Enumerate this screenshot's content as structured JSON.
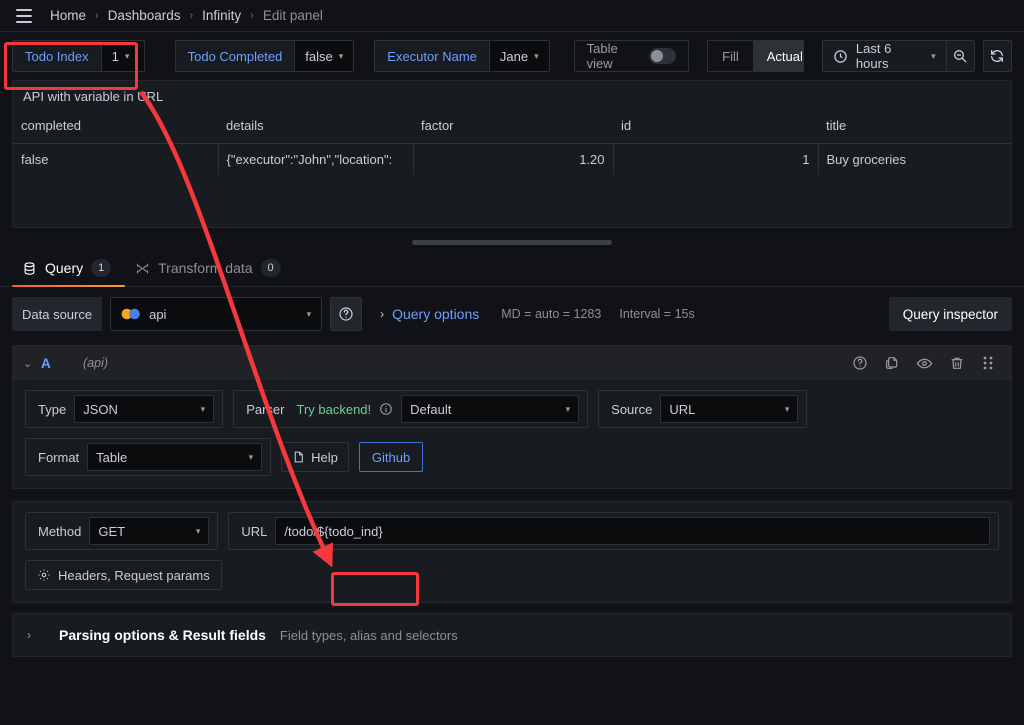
{
  "nav": {
    "menu_icon": "hamburger-menu-icon",
    "breadcrumbs": [
      {
        "label": "Home",
        "current": false
      },
      {
        "label": "Dashboards",
        "current": false
      },
      {
        "label": "Infinity",
        "current": false
      },
      {
        "label": "Edit panel",
        "current": true
      }
    ],
    "separator": "›"
  },
  "submenu": {
    "variables": [
      {
        "name": "Todo Index",
        "value": "1"
      },
      {
        "name": "Todo Completed",
        "value": "false"
      },
      {
        "name": "Executor Name",
        "value": "Jane"
      }
    ],
    "table_view": {
      "label": "Table view",
      "enabled": false
    },
    "fill_actual": {
      "options": [
        "Fill",
        "Actual"
      ],
      "selected": "Actual"
    },
    "time_picker": {
      "icon": "clock-icon",
      "range": "Last 6 hours",
      "caret": "⌄"
    },
    "zoom_out_icon": "zoom-out-icon",
    "refresh_icon": "refresh-icon"
  },
  "panel": {
    "title": "API with variable in URL",
    "table": {
      "columns": [
        "completed",
        "details",
        "factor",
        "id",
        "title"
      ],
      "alignments": [
        "left",
        "left",
        "right",
        "right",
        "left"
      ],
      "rows": [
        [
          "false",
          "{\"executor\":\"John\",\"location\":",
          "1.20",
          "1",
          "Buy groceries"
        ]
      ]
    }
  },
  "resize_handle": "panel-resize-handle",
  "tabs": [
    {
      "label": "Query",
      "badge": "1",
      "icon": "database-icon",
      "active": true
    },
    {
      "label": "Transform data",
      "badge": "0",
      "icon": "transform-icon",
      "active": false
    }
  ],
  "query_toolbar": {
    "data_source_label": "Data source",
    "data_source_value": "api",
    "data_source_icon": "infinity-datasource-icon",
    "help_icon": "help-circle-icon",
    "query_options_chevron": "›",
    "query_options_label": "Query options",
    "query_options_meta": "MD = auto = 1283",
    "query_options_interval": "Interval = 15s",
    "query_inspector_label": "Query inspector"
  },
  "query_row": {
    "collapse_chevron": "⌄",
    "ref_id": "A",
    "datasource_name": "(api)",
    "actions": [
      {
        "icon": "help-circle-icon",
        "name": "query-help-icon"
      },
      {
        "icon": "copy-icon",
        "name": "duplicate-query-icon"
      },
      {
        "icon": "eye-icon",
        "name": "toggle-visibility-icon"
      },
      {
        "icon": "trash-icon",
        "name": "delete-query-icon"
      },
      {
        "icon": "drag-handle-icon",
        "name": "drag-query-icon"
      }
    ],
    "fields": {
      "type_label": "Type",
      "type_value": "JSON",
      "parser_label": "Parser",
      "parser_hint": "Try backend!",
      "parser_info_icon": "info-circle-icon",
      "parser_value": "Default",
      "source_label": "Source",
      "source_value": "URL",
      "format_label": "Format",
      "format_value": "Table",
      "help_button": "Help",
      "help_button_icon": "doc-icon",
      "github_button": "Github",
      "method_label": "Method",
      "method_value": "GET",
      "url_label": "URL",
      "url_value_prefix": "/todo/",
      "url_value_variable": "${todo_ind}",
      "headers_button": "Headers, Request params",
      "headers_button_icon": "gear-icon"
    }
  },
  "parsing_section": {
    "chevron": "›",
    "title": "Parsing options & Result fields",
    "subtitle": "Field types, alias and selectors"
  },
  "annotations": {
    "highlight_color": "#f5383b",
    "boxes": [
      {
        "name": "todo-index-variable-highlight"
      },
      {
        "name": "url-variable-highlight"
      }
    ],
    "arrow": {
      "name": "annotation-arrow",
      "from": "todo-index-variable",
      "to": "url-variable"
    }
  }
}
